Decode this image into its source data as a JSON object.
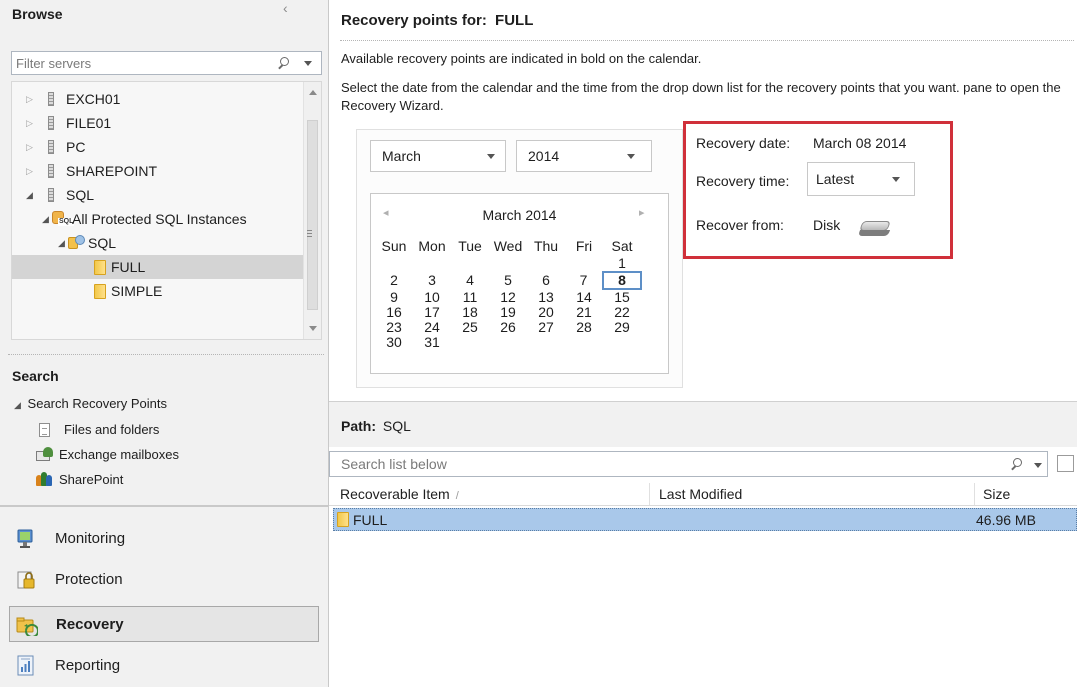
{
  "browse": {
    "title": "Browse",
    "filter_placeholder": "Filter servers",
    "tree": [
      {
        "label": "EXCH01"
      },
      {
        "label": "FILE01"
      },
      {
        "label": "PC"
      },
      {
        "label": "SHAREPOINT"
      },
      {
        "label": "SQL"
      },
      {
        "label": "All Protected SQL Instances",
        "icon_text": "SQL"
      },
      {
        "label": "SQL"
      },
      {
        "label": "FULL",
        "selected": true
      },
      {
        "label": "SIMPLE"
      }
    ]
  },
  "search": {
    "title": "Search",
    "group_label": "Search Recovery Points",
    "items": [
      {
        "label": "Files and folders",
        "icon": "document-icon"
      },
      {
        "label": "Exchange mailboxes",
        "icon": "mailbox-icon"
      },
      {
        "label": "SharePoint",
        "icon": "sharepoint-icon"
      }
    ]
  },
  "nav": [
    {
      "label": "Monitoring",
      "icon": "monitoring-icon"
    },
    {
      "label": "Protection",
      "icon": "protection-icon"
    },
    {
      "label": "Recovery",
      "icon": "recovery-icon",
      "active": true
    },
    {
      "label": "Reporting",
      "icon": "reporting-icon"
    }
  ],
  "recovery_points": {
    "title_prefix": "Recovery points for:",
    "title_target": "FULL",
    "info_line1": "Available recovery points are indicated in bold on the calendar.",
    "info_line2": "Select the date from the calendar and the time from the drop down list for the recovery points that you want. pane to open the Recovery Wizard.",
    "month_select": "March",
    "year_select": "2014",
    "calendar": {
      "title": "March 2014",
      "weekdays": [
        "Sun",
        "Mon",
        "Tue",
        "Wed",
        "Thu",
        "Fri",
        "Sat"
      ],
      "weeks": [
        [
          "",
          "",
          "",
          "",
          "",
          "",
          "1"
        ],
        [
          "2",
          "3",
          "4",
          "5",
          "6",
          "7",
          "8"
        ],
        [
          "9",
          "10",
          "11",
          "12",
          "13",
          "14",
          "15"
        ],
        [
          "16",
          "17",
          "18",
          "19",
          "20",
          "21",
          "22"
        ],
        [
          "23",
          "24",
          "25",
          "26",
          "27",
          "28",
          "29"
        ],
        [
          "30",
          "31",
          "",
          "",
          "",
          "",
          ""
        ]
      ],
      "selected_day": "8"
    },
    "details": {
      "date_label": "Recovery date:",
      "date_value": "March 08 2014",
      "time_label": "Recovery time:",
      "time_value": "Latest",
      "from_label": "Recover from:",
      "from_value": "Disk"
    },
    "highlight_color": "#d0303a"
  },
  "path": {
    "label": "Path:",
    "value": "SQL"
  },
  "list": {
    "search_placeholder": "Search list below",
    "columns": [
      "Recoverable Item",
      "Last Modified",
      "Size"
    ],
    "rows": [
      {
        "name": "FULL",
        "modified": "",
        "size": "46.96 MB",
        "selected": true
      }
    ],
    "selection_color": "#a9c8ea"
  }
}
